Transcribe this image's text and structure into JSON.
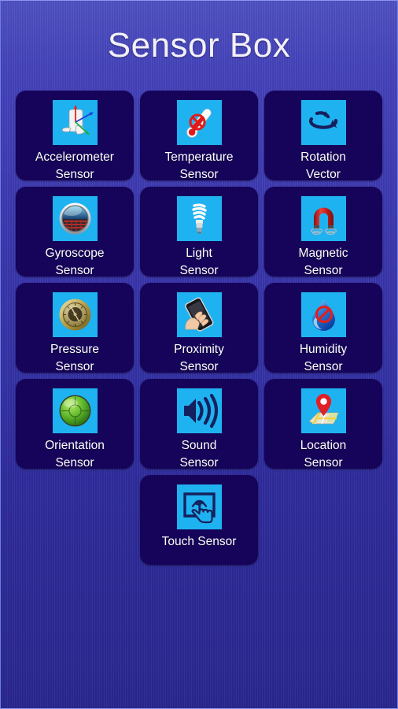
{
  "app": {
    "title": "Sensor Box",
    "background_top_color": "#5052c4",
    "background_bottom_color": "#2a2790",
    "tile_color": "#16045a",
    "icon_bg_color": "#1fb2f0",
    "label_color": "#ffffff",
    "title_color": "#f2f0f8"
  },
  "grid": {
    "tiles": [
      {
        "label": "Accelerometer\nSensor",
        "icon": "accelerometer-icon"
      },
      {
        "label": "Temperature\nSensor",
        "icon": "thermometer-icon"
      },
      {
        "label": "Rotation\nVector",
        "icon": "rotation-vector-icon"
      },
      {
        "label": "Gyroscope\nSensor",
        "icon": "gyroscope-icon"
      },
      {
        "label": "Light\nSensor",
        "icon": "lightbulb-icon"
      },
      {
        "label": "Magnetic\nSensor",
        "icon": "horseshoe-magnet-icon"
      },
      {
        "label": "Pressure\nSensor",
        "icon": "barometer-icon"
      },
      {
        "label": "Proximity\nSensor",
        "icon": "hand-holding-phone-icon"
      },
      {
        "label": "Humidity\nSensor",
        "icon": "water-drop-blocked-icon"
      },
      {
        "label": "Orientation\nSensor",
        "icon": "bubble-level-icon"
      },
      {
        "label": "Sound\nSensor",
        "icon": "speaker-waves-icon"
      },
      {
        "label": "Location\nSensor",
        "icon": "map-pin-icon"
      },
      {
        "label": "Touch Sensor",
        "icon": "touch-screen-icon"
      }
    ]
  }
}
